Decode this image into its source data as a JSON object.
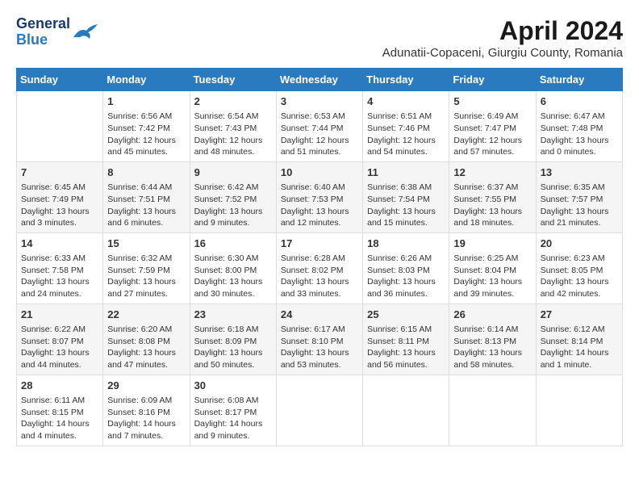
{
  "title": "April 2024",
  "subtitle": "Adunatii-Copaceni, Giurgiu County, Romania",
  "logo": {
    "line1": "General",
    "line2": "Blue"
  },
  "days_of_week": [
    "Sunday",
    "Monday",
    "Tuesday",
    "Wednesday",
    "Thursday",
    "Friday",
    "Saturday"
  ],
  "weeks": [
    [
      {
        "day": "",
        "info": ""
      },
      {
        "day": "1",
        "info": "Sunrise: 6:56 AM\nSunset: 7:42 PM\nDaylight: 12 hours\nand 45 minutes."
      },
      {
        "day": "2",
        "info": "Sunrise: 6:54 AM\nSunset: 7:43 PM\nDaylight: 12 hours\nand 48 minutes."
      },
      {
        "day": "3",
        "info": "Sunrise: 6:53 AM\nSunset: 7:44 PM\nDaylight: 12 hours\nand 51 minutes."
      },
      {
        "day": "4",
        "info": "Sunrise: 6:51 AM\nSunset: 7:46 PM\nDaylight: 12 hours\nand 54 minutes."
      },
      {
        "day": "5",
        "info": "Sunrise: 6:49 AM\nSunset: 7:47 PM\nDaylight: 12 hours\nand 57 minutes."
      },
      {
        "day": "6",
        "info": "Sunrise: 6:47 AM\nSunset: 7:48 PM\nDaylight: 13 hours\nand 0 minutes."
      }
    ],
    [
      {
        "day": "7",
        "info": "Sunrise: 6:45 AM\nSunset: 7:49 PM\nDaylight: 13 hours\nand 3 minutes."
      },
      {
        "day": "8",
        "info": "Sunrise: 6:44 AM\nSunset: 7:51 PM\nDaylight: 13 hours\nand 6 minutes."
      },
      {
        "day": "9",
        "info": "Sunrise: 6:42 AM\nSunset: 7:52 PM\nDaylight: 13 hours\nand 9 minutes."
      },
      {
        "day": "10",
        "info": "Sunrise: 6:40 AM\nSunset: 7:53 PM\nDaylight: 13 hours\nand 12 minutes."
      },
      {
        "day": "11",
        "info": "Sunrise: 6:38 AM\nSunset: 7:54 PM\nDaylight: 13 hours\nand 15 minutes."
      },
      {
        "day": "12",
        "info": "Sunrise: 6:37 AM\nSunset: 7:55 PM\nDaylight: 13 hours\nand 18 minutes."
      },
      {
        "day": "13",
        "info": "Sunrise: 6:35 AM\nSunset: 7:57 PM\nDaylight: 13 hours\nand 21 minutes."
      }
    ],
    [
      {
        "day": "14",
        "info": "Sunrise: 6:33 AM\nSunset: 7:58 PM\nDaylight: 13 hours\nand 24 minutes."
      },
      {
        "day": "15",
        "info": "Sunrise: 6:32 AM\nSunset: 7:59 PM\nDaylight: 13 hours\nand 27 minutes."
      },
      {
        "day": "16",
        "info": "Sunrise: 6:30 AM\nSunset: 8:00 PM\nDaylight: 13 hours\nand 30 minutes."
      },
      {
        "day": "17",
        "info": "Sunrise: 6:28 AM\nSunset: 8:02 PM\nDaylight: 13 hours\nand 33 minutes."
      },
      {
        "day": "18",
        "info": "Sunrise: 6:26 AM\nSunset: 8:03 PM\nDaylight: 13 hours\nand 36 minutes."
      },
      {
        "day": "19",
        "info": "Sunrise: 6:25 AM\nSunset: 8:04 PM\nDaylight: 13 hours\nand 39 minutes."
      },
      {
        "day": "20",
        "info": "Sunrise: 6:23 AM\nSunset: 8:05 PM\nDaylight: 13 hours\nand 42 minutes."
      }
    ],
    [
      {
        "day": "21",
        "info": "Sunrise: 6:22 AM\nSunset: 8:07 PM\nDaylight: 13 hours\nand 44 minutes."
      },
      {
        "day": "22",
        "info": "Sunrise: 6:20 AM\nSunset: 8:08 PM\nDaylight: 13 hours\nand 47 minutes."
      },
      {
        "day": "23",
        "info": "Sunrise: 6:18 AM\nSunset: 8:09 PM\nDaylight: 13 hours\nand 50 minutes."
      },
      {
        "day": "24",
        "info": "Sunrise: 6:17 AM\nSunset: 8:10 PM\nDaylight: 13 hours\nand 53 minutes."
      },
      {
        "day": "25",
        "info": "Sunrise: 6:15 AM\nSunset: 8:11 PM\nDaylight: 13 hours\nand 56 minutes."
      },
      {
        "day": "26",
        "info": "Sunrise: 6:14 AM\nSunset: 8:13 PM\nDaylight: 13 hours\nand 58 minutes."
      },
      {
        "day": "27",
        "info": "Sunrise: 6:12 AM\nSunset: 8:14 PM\nDaylight: 14 hours\nand 1 minute."
      }
    ],
    [
      {
        "day": "28",
        "info": "Sunrise: 6:11 AM\nSunset: 8:15 PM\nDaylight: 14 hours\nand 4 minutes."
      },
      {
        "day": "29",
        "info": "Sunrise: 6:09 AM\nSunset: 8:16 PM\nDaylight: 14 hours\nand 7 minutes."
      },
      {
        "day": "30",
        "info": "Sunrise: 6:08 AM\nSunset: 8:17 PM\nDaylight: 14 hours\nand 9 minutes."
      },
      {
        "day": "",
        "info": ""
      },
      {
        "day": "",
        "info": ""
      },
      {
        "day": "",
        "info": ""
      },
      {
        "day": "",
        "info": ""
      }
    ]
  ]
}
